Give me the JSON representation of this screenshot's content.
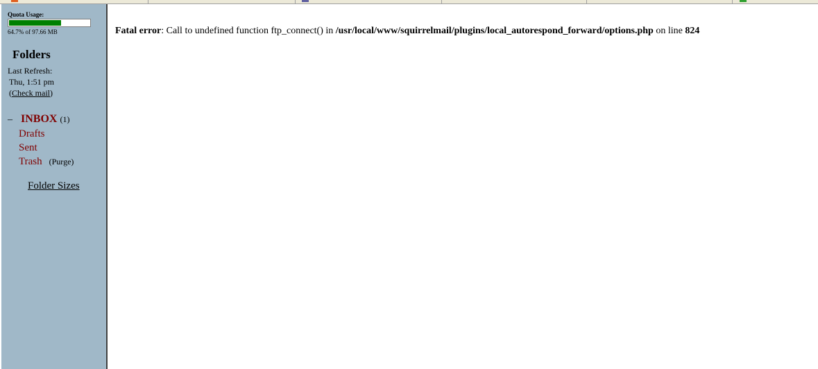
{
  "sidebar": {
    "quota": {
      "label": "Quota Usage:",
      "percent": 64.7,
      "text": "64.7% of 97.66 MB",
      "fill_color": "#008000"
    },
    "folders_title": "Folders",
    "last_refresh_label": "Last Refresh:",
    "last_refresh_time": "Thu, 1:51 pm",
    "check_mail_open": "(",
    "check_mail_label": "Check mail",
    "check_mail_close": ")",
    "collapse_symbol": "–",
    "folders": [
      {
        "name": "INBOX",
        "unread": "(1)"
      },
      {
        "name": "Drafts"
      },
      {
        "name": "Sent"
      },
      {
        "name": "Trash",
        "action": "(Purge)"
      }
    ],
    "folder_sizes_label": "Folder Sizes",
    "background_color": "#a0b8c8",
    "link_color": "#800000"
  },
  "content": {
    "error": {
      "prefix": "Fatal error",
      "message": ": Call to undefined function ftp_connect() in ",
      "path": "/usr/local/www/squirrelmail/plugins/local_autorespond_forward/options.php",
      "on_line": " on line ",
      "line_number": "824"
    }
  }
}
